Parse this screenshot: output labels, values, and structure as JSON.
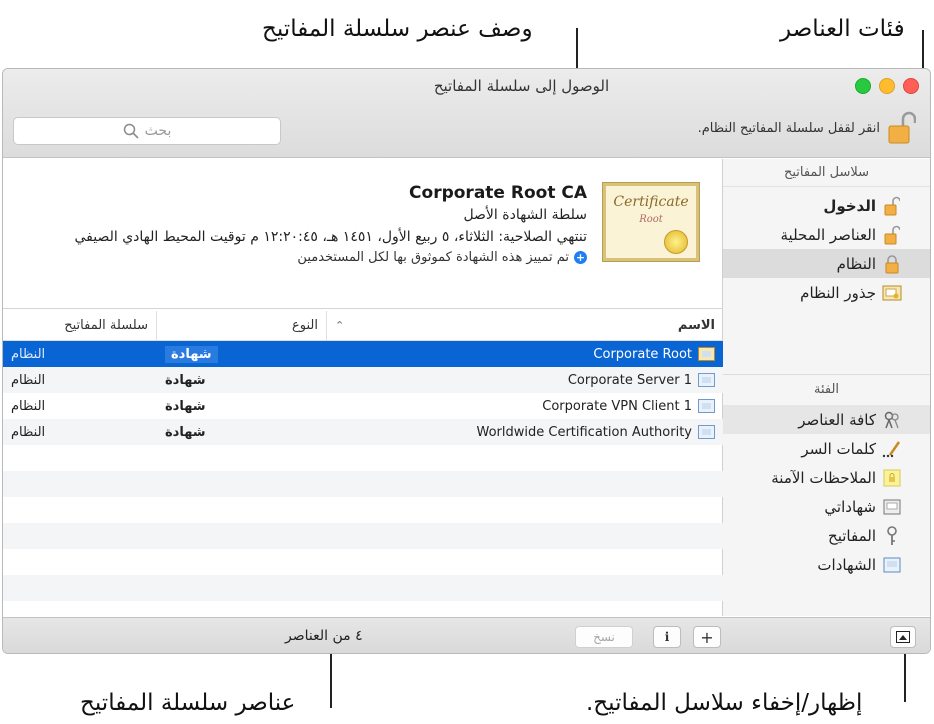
{
  "callouts": {
    "keychain_item_description": "وصف عنصر سلسلة المفاتيح",
    "item_categories": "فئات العناصر",
    "keychain_items": "عناصر سلسلة المفاتيح",
    "show_hide_keychains": "إظهار/إخفاء سلاسل المفاتيح."
  },
  "window": {
    "title": "الوصول إلى سلسلة المفاتيح",
    "lock_label": "انقر لقفل سلسلة المفاتيح النظام.",
    "search_placeholder": "بحث"
  },
  "sidebar": {
    "keychains_header": "سلاسل المفاتيح",
    "keychains": [
      {
        "label": "الدخول",
        "icon": "unlocked-padlock-icon"
      },
      {
        "label": "العناصر المحلية",
        "icon": "unlocked-padlock-icon"
      },
      {
        "label": "النظام",
        "icon": "padlock-icon"
      },
      {
        "label": "جذور النظام",
        "icon": "certificate-folder-icon"
      }
    ],
    "category_header": "الفئة",
    "categories": [
      {
        "label": "كافة العناصر",
        "icon": "all-items-icon"
      },
      {
        "label": "كلمات السر",
        "icon": "password-icon"
      },
      {
        "label": "الملاحظات الآمنة",
        "icon": "secure-note-icon"
      },
      {
        "label": "شهاداتي",
        "icon": "my-certificate-icon"
      },
      {
        "label": "المفاتيح",
        "icon": "key-icon"
      },
      {
        "label": "الشهادات",
        "icon": "certificate-icon"
      }
    ]
  },
  "detail": {
    "cert_image_text": "Certificate",
    "cert_image_subtext": "Root",
    "title": "Corporate Root CA",
    "subtitle": "سلطة الشهادة الأصل",
    "expiry": "تنتهي الصلاحية: الثلاثاء، ٥ ربيع الأول، ١٤٥١ هـ، ١٢:٢٠:٤٥ م توقيت المحيط الهادي الصيفي",
    "trust": "تم تمييز هذه الشهادة كموثوق بها لكل المستخدمين"
  },
  "table": {
    "columns": {
      "name": "الاسم",
      "kind": "النوع",
      "keychain": "سلسلة المفاتيح"
    },
    "rows": [
      {
        "name": "Corporate Root",
        "kind": "شهادة",
        "keychain": "النظام"
      },
      {
        "name": "Corporate Server 1",
        "kind": "شهادة",
        "keychain": "النظام"
      },
      {
        "name": "Corporate VPN Client 1",
        "kind": "شهادة",
        "keychain": "النظام"
      },
      {
        "name": "Worldwide Certification Authority",
        "kind": "شهادة",
        "keychain": "النظام"
      }
    ]
  },
  "bottom": {
    "copy_label": "نسخ",
    "info_label": "i",
    "add_label": "+",
    "count": "٤ من العناصر"
  },
  "colors": {
    "selection": "#0964d4",
    "close": "#ff5f57",
    "minimize": "#febc2e",
    "zoom": "#28c840"
  }
}
